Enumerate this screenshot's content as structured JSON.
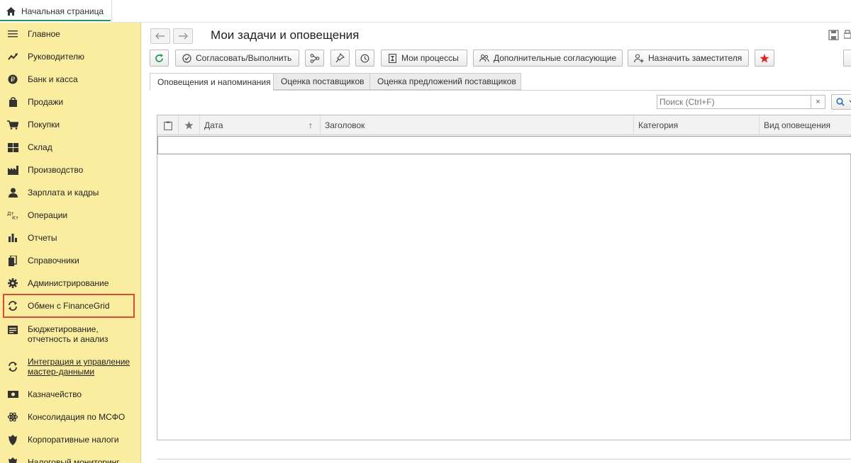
{
  "topbar": {
    "home_tab_label": "Начальная страница",
    "home_icon": "home-icon"
  },
  "sidebar": {
    "items": [
      {
        "label": "Главное",
        "icon": "menu-icon"
      },
      {
        "label": "Руководителю",
        "icon": "trend-icon"
      },
      {
        "label": "Банк и касса",
        "icon": "coin-icon"
      },
      {
        "label": "Продажи",
        "icon": "bag-icon"
      },
      {
        "label": "Покупки",
        "icon": "cart-icon"
      },
      {
        "label": "Склад",
        "icon": "warehouse-icon"
      },
      {
        "label": "Производство",
        "icon": "factory-icon"
      },
      {
        "label": "Зарплата и кадры",
        "icon": "person-icon"
      },
      {
        "label": "Операции",
        "icon": "dt-kt-icon"
      },
      {
        "label": "Отчеты",
        "icon": "bar-chart-icon"
      },
      {
        "label": "Справочники",
        "icon": "books-icon"
      },
      {
        "label": "Администрирование",
        "icon": "gear-icon"
      },
      {
        "label": "Обмен с FinanceGrid",
        "icon": "sync-icon"
      },
      {
        "label_line1": "Бюджетирование,",
        "label_line2": "отчетность и анализ",
        "icon": "budget-icon"
      },
      {
        "label_line1": "Интеграция и управление",
        "label_line2": "мастер-данными",
        "icon": "sync-icon"
      },
      {
        "label": "Казначейство",
        "icon": "treasury-icon"
      },
      {
        "label": "Консолидация по МСФО",
        "icon": "atom-icon"
      },
      {
        "label": "Корпоративные налоги",
        "icon": "emblem-icon"
      },
      {
        "label": "Налоговый мониторинг",
        "icon": "emblem-icon"
      }
    ]
  },
  "main": {
    "title": "Мои задачи и оповещения",
    "toolbar": {
      "approve_label": "Согласовать/Выполнить",
      "my_processes_label": "Мои процессы",
      "additional_approvers_label": "Дополнительные согласующие",
      "assign_deputy_label": "Назначить заместителя"
    },
    "tabs": [
      "Оповещения и напоминания",
      "Оценка поставщиков",
      "Оценка предложений поставщиков"
    ],
    "search": {
      "placeholder": "Поиск (Ctrl+F)",
      "clear": "×"
    },
    "grid": {
      "columns": [
        "Дата",
        "Заголовок",
        "Категория",
        "Вид оповещения"
      ],
      "sort_indicator": "↑"
    }
  },
  "colors": {
    "sidebar_bg": "#fbeda0",
    "highlight": "#d94a3b",
    "accent_green": "#2d9b58",
    "star_red": "#e32222"
  }
}
